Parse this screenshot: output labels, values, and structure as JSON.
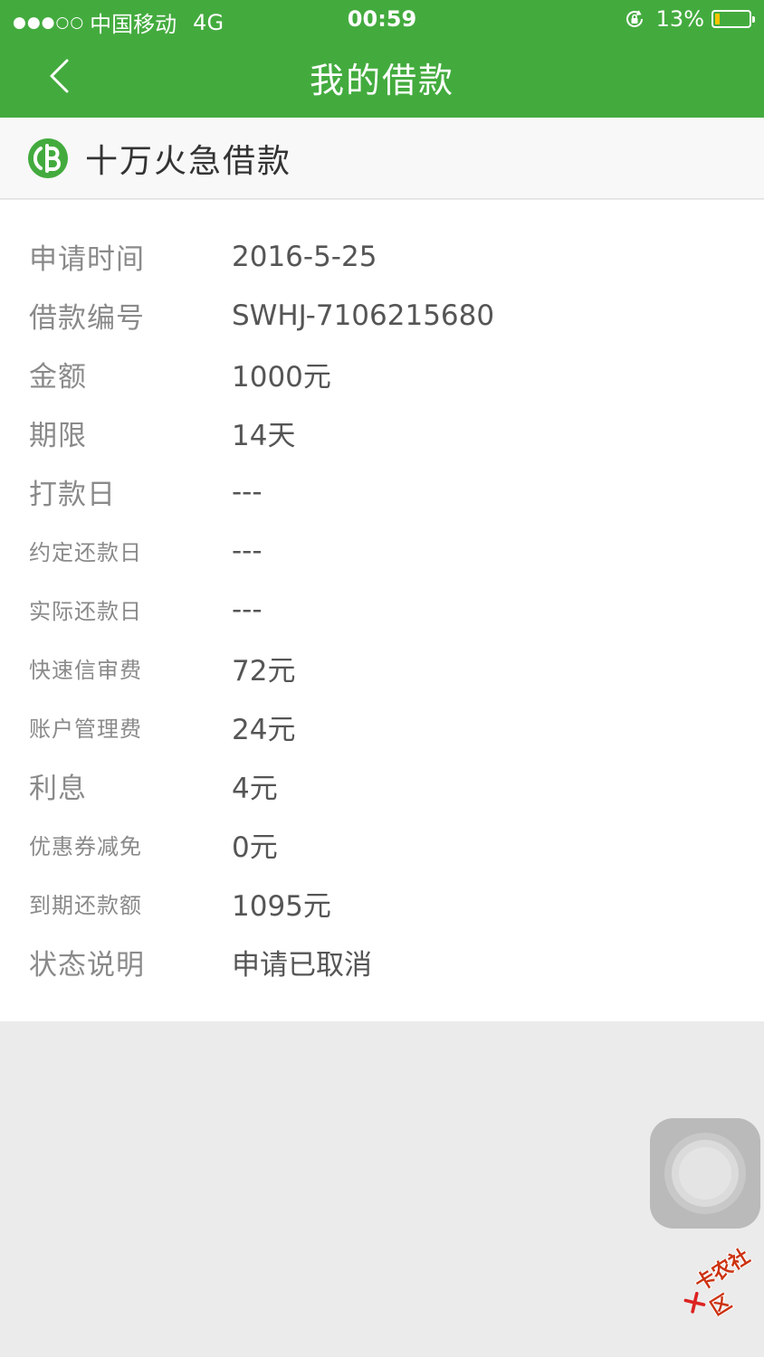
{
  "status_bar": {
    "signal": "●●●○○",
    "carrier": "中国移动",
    "network": "4G",
    "time": "00:59",
    "battery_percent": "13%",
    "battery_level": 0.13
  },
  "nav": {
    "title": "我的借款"
  },
  "product": {
    "name": "十万火急借款",
    "logo_icon": "coin-logo-icon",
    "accent_color": "#43ab3e"
  },
  "details": [
    {
      "label": "申请时间",
      "value": "2016-5-25"
    },
    {
      "label": "借款编号",
      "value": "SWHJ-7106215680"
    },
    {
      "label": "金额",
      "value": "1000元"
    },
    {
      "label": "期限",
      "value": "14天"
    },
    {
      "label": "打款日",
      "value": "---"
    },
    {
      "label": "约定还款日",
      "value": "---"
    },
    {
      "label": "实际还款日",
      "value": "---"
    },
    {
      "label": "快速信审费",
      "value": "72元"
    },
    {
      "label": "账户管理费",
      "value": "24元"
    },
    {
      "label": "利息",
      "value": "4元"
    },
    {
      "label": "优惠券减免",
      "value": "0元"
    },
    {
      "label": "到期还款额",
      "value": "1095元"
    },
    {
      "label": "状态说明",
      "value": "申请已取消"
    }
  ],
  "watermark": {
    "text": "卡农社区"
  }
}
